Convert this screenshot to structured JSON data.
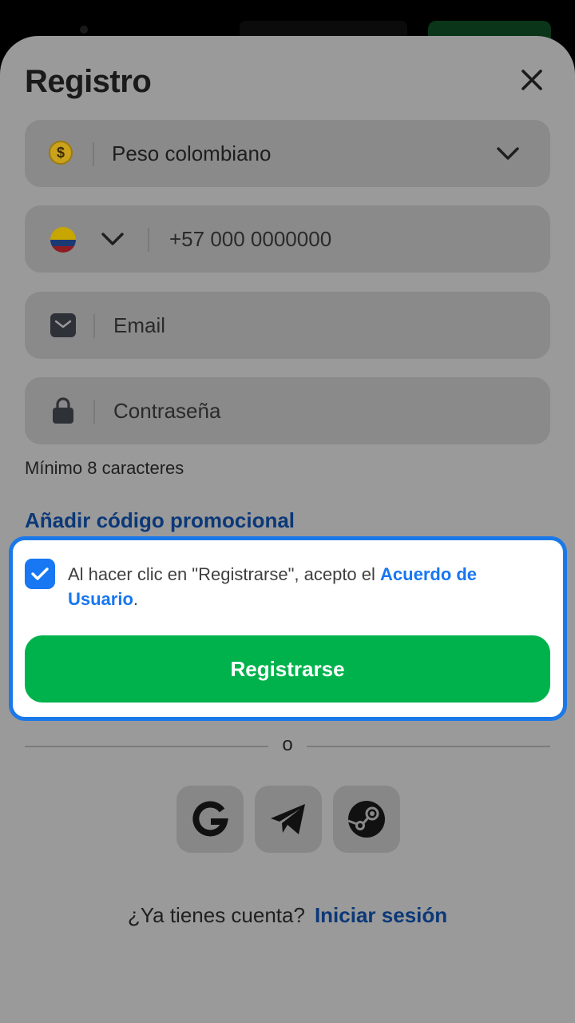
{
  "form": {
    "title": "Registro",
    "currency": {
      "value": "Peso colombiano",
      "icon": "dollar-coin-icon",
      "symbol": "$"
    },
    "phone": {
      "placeholder": "+57 000 0000000",
      "country_icon": "colombia-flag-icon"
    },
    "email": {
      "placeholder": "Email",
      "icon": "envelope-icon"
    },
    "password": {
      "placeholder": "Contraseña",
      "icon": "lock-icon",
      "hint": "Mínimo 8 caracteres"
    },
    "promo_link": "Añadir código promocional",
    "agreement": {
      "checked": true,
      "text_before": "Al hacer clic en \"Registrarse\", acepto el ",
      "link_text": "Acuerdo de Usuario",
      "text_after": "."
    },
    "submit_label": "Registrarse",
    "divider_label": "o",
    "social": [
      "google-icon",
      "telegram-icon",
      "steam-icon"
    ],
    "footer": {
      "question": "¿Ya tienes cuenta?",
      "login_link": "Iniciar sesión"
    }
  },
  "colors": {
    "accent_blue": "#1877f2",
    "link_dark_blue": "#0b3878",
    "primary_green": "#00b24c"
  }
}
